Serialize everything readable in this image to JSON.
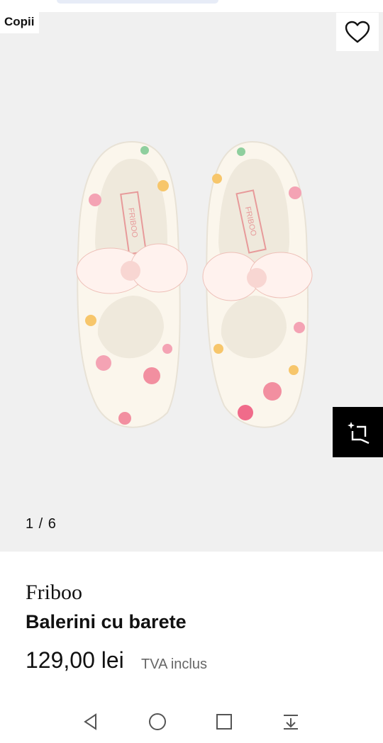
{
  "gallery": {
    "category_badge": "Copii",
    "counter": "1 / 6",
    "background": "#f0f0f0",
    "icons": {
      "wishlist": "heart-outline-icon",
      "try_on": "ar-sparkle-icon"
    }
  },
  "product": {
    "brand": "Friboo",
    "name": "Balerini cu barete",
    "price": "129,00 lei",
    "vat_note": "TVA inclus",
    "image_alt": "Balerini cu barete Friboo, imprimeu floral"
  },
  "system_nav": {
    "icons": [
      "back-triangle-icon",
      "home-circle-icon",
      "recents-square-icon",
      "notifications-down-icon"
    ]
  },
  "colors": {
    "text": "#111111",
    "muted": "#666666",
    "accent_black": "#000000"
  }
}
